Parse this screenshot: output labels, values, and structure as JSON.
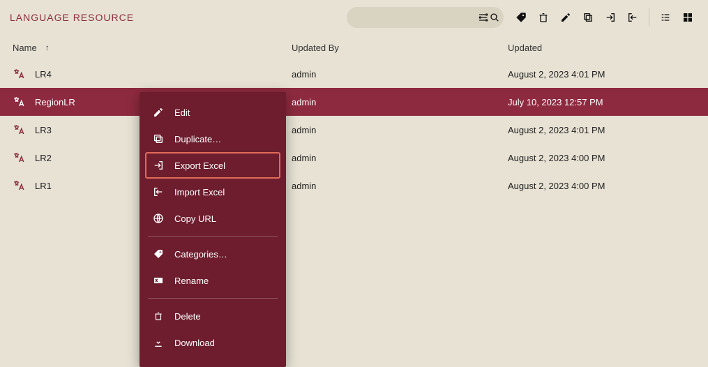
{
  "page_title": "LANGUAGE RESOURCE",
  "columns": {
    "name": "Name",
    "updated_by": "Updated By",
    "updated": "Updated"
  },
  "search": {
    "placeholder": ""
  },
  "rows": [
    {
      "name": "LR4",
      "updated_by": "admin",
      "updated": "August 2, 2023 4:01 PM",
      "selected": false
    },
    {
      "name": "RegionLR",
      "updated_by": "admin",
      "updated": "July 10, 2023 12:57 PM",
      "selected": true
    },
    {
      "name": "LR3",
      "updated_by": "admin",
      "updated": "August 2, 2023 4:01 PM",
      "selected": false
    },
    {
      "name": "LR2",
      "updated_by": "admin",
      "updated": "August 2, 2023 4:00 PM",
      "selected": false
    },
    {
      "name": "LR1",
      "updated_by": "admin",
      "updated": "August 2, 2023 4:00 PM",
      "selected": false
    }
  ],
  "context_menu": {
    "edit": "Edit",
    "duplicate": "Duplicate…",
    "export_excel": "Export Excel",
    "import_excel": "Import Excel",
    "copy_url": "Copy URL",
    "categories": "Categories…",
    "rename": "Rename",
    "delete": "Delete",
    "download": "Download"
  }
}
